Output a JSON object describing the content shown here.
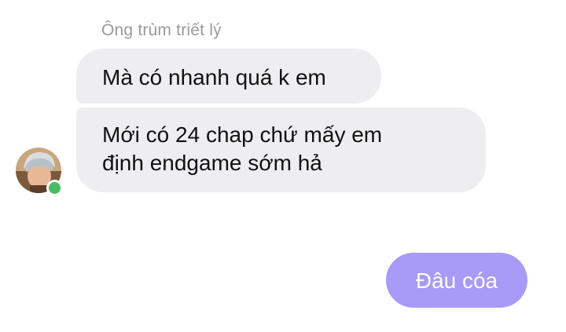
{
  "conversation": {
    "sender_name": "Ông trùm triết lý",
    "incoming": [
      {
        "text": "Mà có nhanh quá k em"
      },
      {
        "text": "Mới có 24 chap chứ mấy em\nđịnh endgame sớm hả"
      }
    ],
    "outgoing": [
      {
        "text": "Đâu cóa"
      }
    ],
    "avatar": {
      "icon": "user-avatar-photo",
      "online": true
    },
    "colors": {
      "incoming_bubble": "#eeeef0",
      "outgoing_bubble": "#a89af7",
      "online_dot": "#45bd62",
      "sender_name": "#9a9a9a"
    }
  }
}
